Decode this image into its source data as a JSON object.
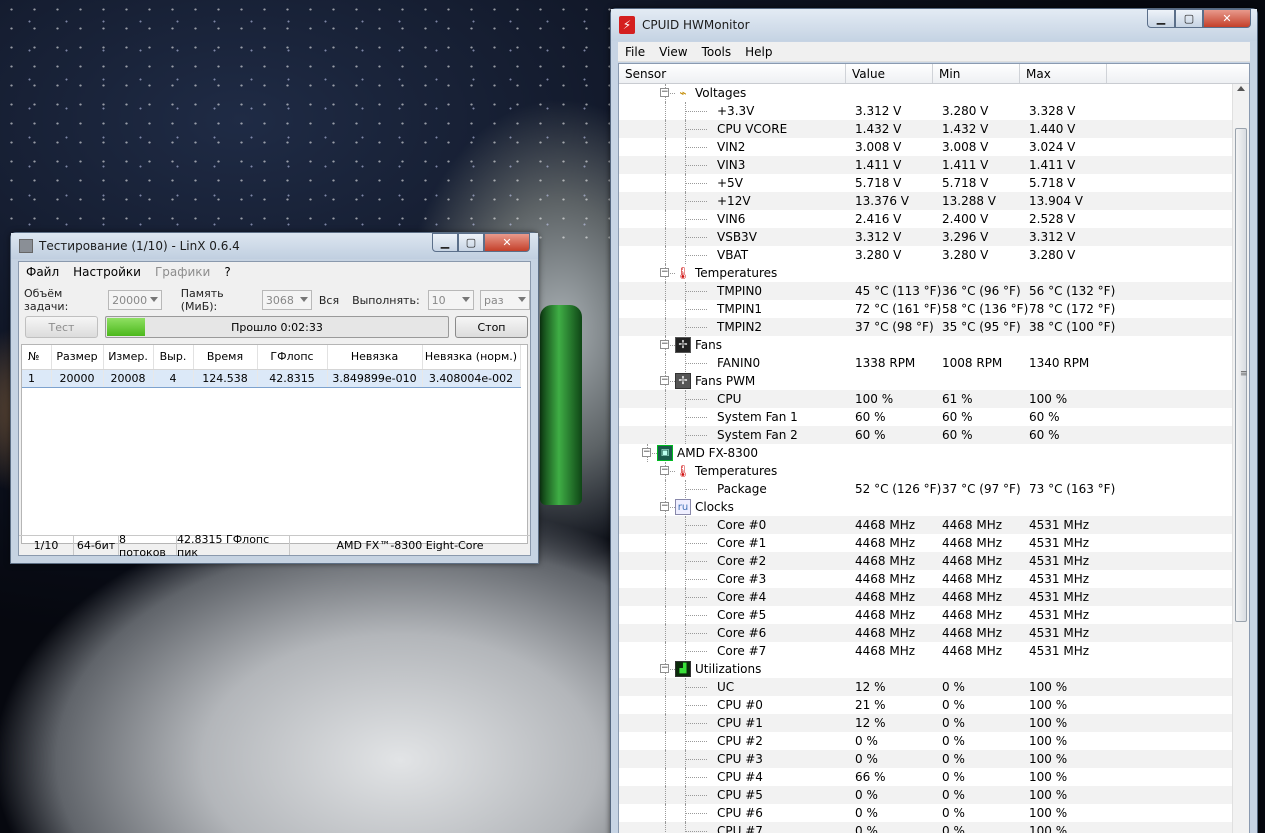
{
  "linx": {
    "title": "Тестирование (1/10) - LinX 0.6.4",
    "menu": [
      "Файл",
      "Настройки",
      "Графики",
      "?"
    ],
    "size_label": "Объём задачи:",
    "size_value": "20000",
    "memory_label": "Память (МиБ):",
    "memory_value": "3068",
    "all_label": "Вся",
    "run_label": "Выполнять:",
    "run_value": "10",
    "run_unit": "раз",
    "test_button": "Тест",
    "progress_text": "Прошло 0:02:33",
    "progress_fraction": 0.11,
    "stop_button": "Стоп",
    "columns": [
      "№",
      "Размер",
      "Измер.",
      "Выр.",
      "Время",
      "ГФлопс",
      "Невязка",
      "Невязка (норм.)"
    ],
    "rows": [
      [
        "1",
        "20000",
        "20008",
        "4",
        "124.538",
        "42.8315",
        "3.849899e-010",
        "3.408004e-002"
      ]
    ],
    "status": [
      "1/10",
      "64-бит",
      "8 потоков",
      "42.8315 ГФлопс пик",
      "AMD FX™-8300 Eight-Core"
    ]
  },
  "hw": {
    "title": "CPUID HWMonitor",
    "menu": [
      "File",
      "View",
      "Tools",
      "Help"
    ],
    "columns": [
      "Sensor",
      "Value",
      "Min",
      "Max"
    ],
    "rows": [
      {
        "lvl": 1,
        "group": true,
        "icon": "volt",
        "label": "Voltages"
      },
      {
        "lvl": 2,
        "label": "+3.3V",
        "v": "3.312 V",
        "mn": "3.280 V",
        "mx": "3.328 V"
      },
      {
        "lvl": 2,
        "label": "CPU VCORE",
        "v": "1.432 V",
        "mn": "1.432 V",
        "mx": "1.440 V"
      },
      {
        "lvl": 2,
        "label": "VIN2",
        "v": "3.008 V",
        "mn": "3.008 V",
        "mx": "3.024 V"
      },
      {
        "lvl": 2,
        "label": "VIN3",
        "v": "1.411 V",
        "mn": "1.411 V",
        "mx": "1.411 V"
      },
      {
        "lvl": 2,
        "label": "+5V",
        "v": "5.718 V",
        "mn": "5.718 V",
        "mx": "5.718 V"
      },
      {
        "lvl": 2,
        "label": "+12V",
        "v": "13.376 V",
        "mn": "13.288 V",
        "mx": "13.904 V"
      },
      {
        "lvl": 2,
        "label": "VIN6",
        "v": "2.416 V",
        "mn": "2.400 V",
        "mx": "2.528 V"
      },
      {
        "lvl": 2,
        "label": "VSB3V",
        "v": "3.312 V",
        "mn": "3.296 V",
        "mx": "3.312 V"
      },
      {
        "lvl": 2,
        "label": "VBAT",
        "v": "3.280 V",
        "mn": "3.280 V",
        "mx": "3.280 V"
      },
      {
        "lvl": 1,
        "group": true,
        "icon": "temp",
        "label": "Temperatures"
      },
      {
        "lvl": 2,
        "label": "TMPIN0",
        "v": "45 °C  (113 °F)",
        "mn": "36 °C  (96 °F)",
        "mx": "56 °C  (132 °F)"
      },
      {
        "lvl": 2,
        "label": "TMPIN1",
        "v": "72 °C  (161 °F)",
        "mn": "58 °C  (136 °F)",
        "mx": "78 °C  (172 °F)"
      },
      {
        "lvl": 2,
        "label": "TMPIN2",
        "v": "37 °C  (98 °F)",
        "mn": "35 °C  (95 °F)",
        "mx": "38 °C  (100 °F)"
      },
      {
        "lvl": 1,
        "group": true,
        "icon": "fan",
        "label": "Fans"
      },
      {
        "lvl": 2,
        "label": "FANIN0",
        "v": "1338 RPM",
        "mn": "1008 RPM",
        "mx": "1340 RPM"
      },
      {
        "lvl": 1,
        "group": true,
        "icon": "fanpwm",
        "label": "Fans PWM"
      },
      {
        "lvl": 2,
        "label": "CPU",
        "v": "100 %",
        "mn": "61 %",
        "mx": "100 %"
      },
      {
        "lvl": 2,
        "label": "System Fan 1",
        "v": "60 %",
        "mn": "60 %",
        "mx": "60 %"
      },
      {
        "lvl": 2,
        "label": "System Fan 2",
        "v": "60 %",
        "mn": "60 %",
        "mx": "60 %"
      },
      {
        "lvl": 0,
        "group": true,
        "icon": "cpu",
        "label": "AMD FX-8300"
      },
      {
        "lvl": 1,
        "group": true,
        "icon": "temp",
        "label": "Temperatures"
      },
      {
        "lvl": 2,
        "label": "Package",
        "v": "52 °C  (126 °F)",
        "mn": "37 °C  (97 °F)",
        "mx": "73 °C  (163 °F)"
      },
      {
        "lvl": 1,
        "group": true,
        "icon": "clock",
        "label": "Clocks"
      },
      {
        "lvl": 2,
        "label": "Core #0",
        "v": "4468 MHz",
        "mn": "4468 MHz",
        "mx": "4531 MHz"
      },
      {
        "lvl": 2,
        "label": "Core #1",
        "v": "4468 MHz",
        "mn": "4468 MHz",
        "mx": "4531 MHz"
      },
      {
        "lvl": 2,
        "label": "Core #2",
        "v": "4468 MHz",
        "mn": "4468 MHz",
        "mx": "4531 MHz"
      },
      {
        "lvl": 2,
        "label": "Core #3",
        "v": "4468 MHz",
        "mn": "4468 MHz",
        "mx": "4531 MHz"
      },
      {
        "lvl": 2,
        "label": "Core #4",
        "v": "4468 MHz",
        "mn": "4468 MHz",
        "mx": "4531 MHz"
      },
      {
        "lvl": 2,
        "label": "Core #5",
        "v": "4468 MHz",
        "mn": "4468 MHz",
        "mx": "4531 MHz"
      },
      {
        "lvl": 2,
        "label": "Core #6",
        "v": "4468 MHz",
        "mn": "4468 MHz",
        "mx": "4531 MHz"
      },
      {
        "lvl": 2,
        "label": "Core #7",
        "v": "4468 MHz",
        "mn": "4468 MHz",
        "mx": "4531 MHz"
      },
      {
        "lvl": 1,
        "group": true,
        "icon": "util",
        "label": "Utilizations"
      },
      {
        "lvl": 2,
        "label": "UC",
        "v": "12 %",
        "mn": "0 %",
        "mx": "100 %"
      },
      {
        "lvl": 2,
        "label": "CPU #0",
        "v": "21 %",
        "mn": "0 %",
        "mx": "100 %"
      },
      {
        "lvl": 2,
        "label": "CPU #1",
        "v": "12 %",
        "mn": "0 %",
        "mx": "100 %"
      },
      {
        "lvl": 2,
        "label": "CPU #2",
        "v": "0 %",
        "mn": "0 %",
        "mx": "100 %"
      },
      {
        "lvl": 2,
        "label": "CPU #3",
        "v": "0 %",
        "mn": "0 %",
        "mx": "100 %"
      },
      {
        "lvl": 2,
        "label": "CPU #4",
        "v": "66 %",
        "mn": "0 %",
        "mx": "100 %"
      },
      {
        "lvl": 2,
        "label": "CPU #5",
        "v": "0 %",
        "mn": "0 %",
        "mx": "100 %"
      },
      {
        "lvl": 2,
        "label": "CPU #6",
        "v": "0 %",
        "mn": "0 %",
        "mx": "100 %"
      },
      {
        "lvl": 2,
        "label": "CPU #7",
        "v": "0 %",
        "mn": "0 %",
        "mx": "100 %"
      }
    ]
  }
}
